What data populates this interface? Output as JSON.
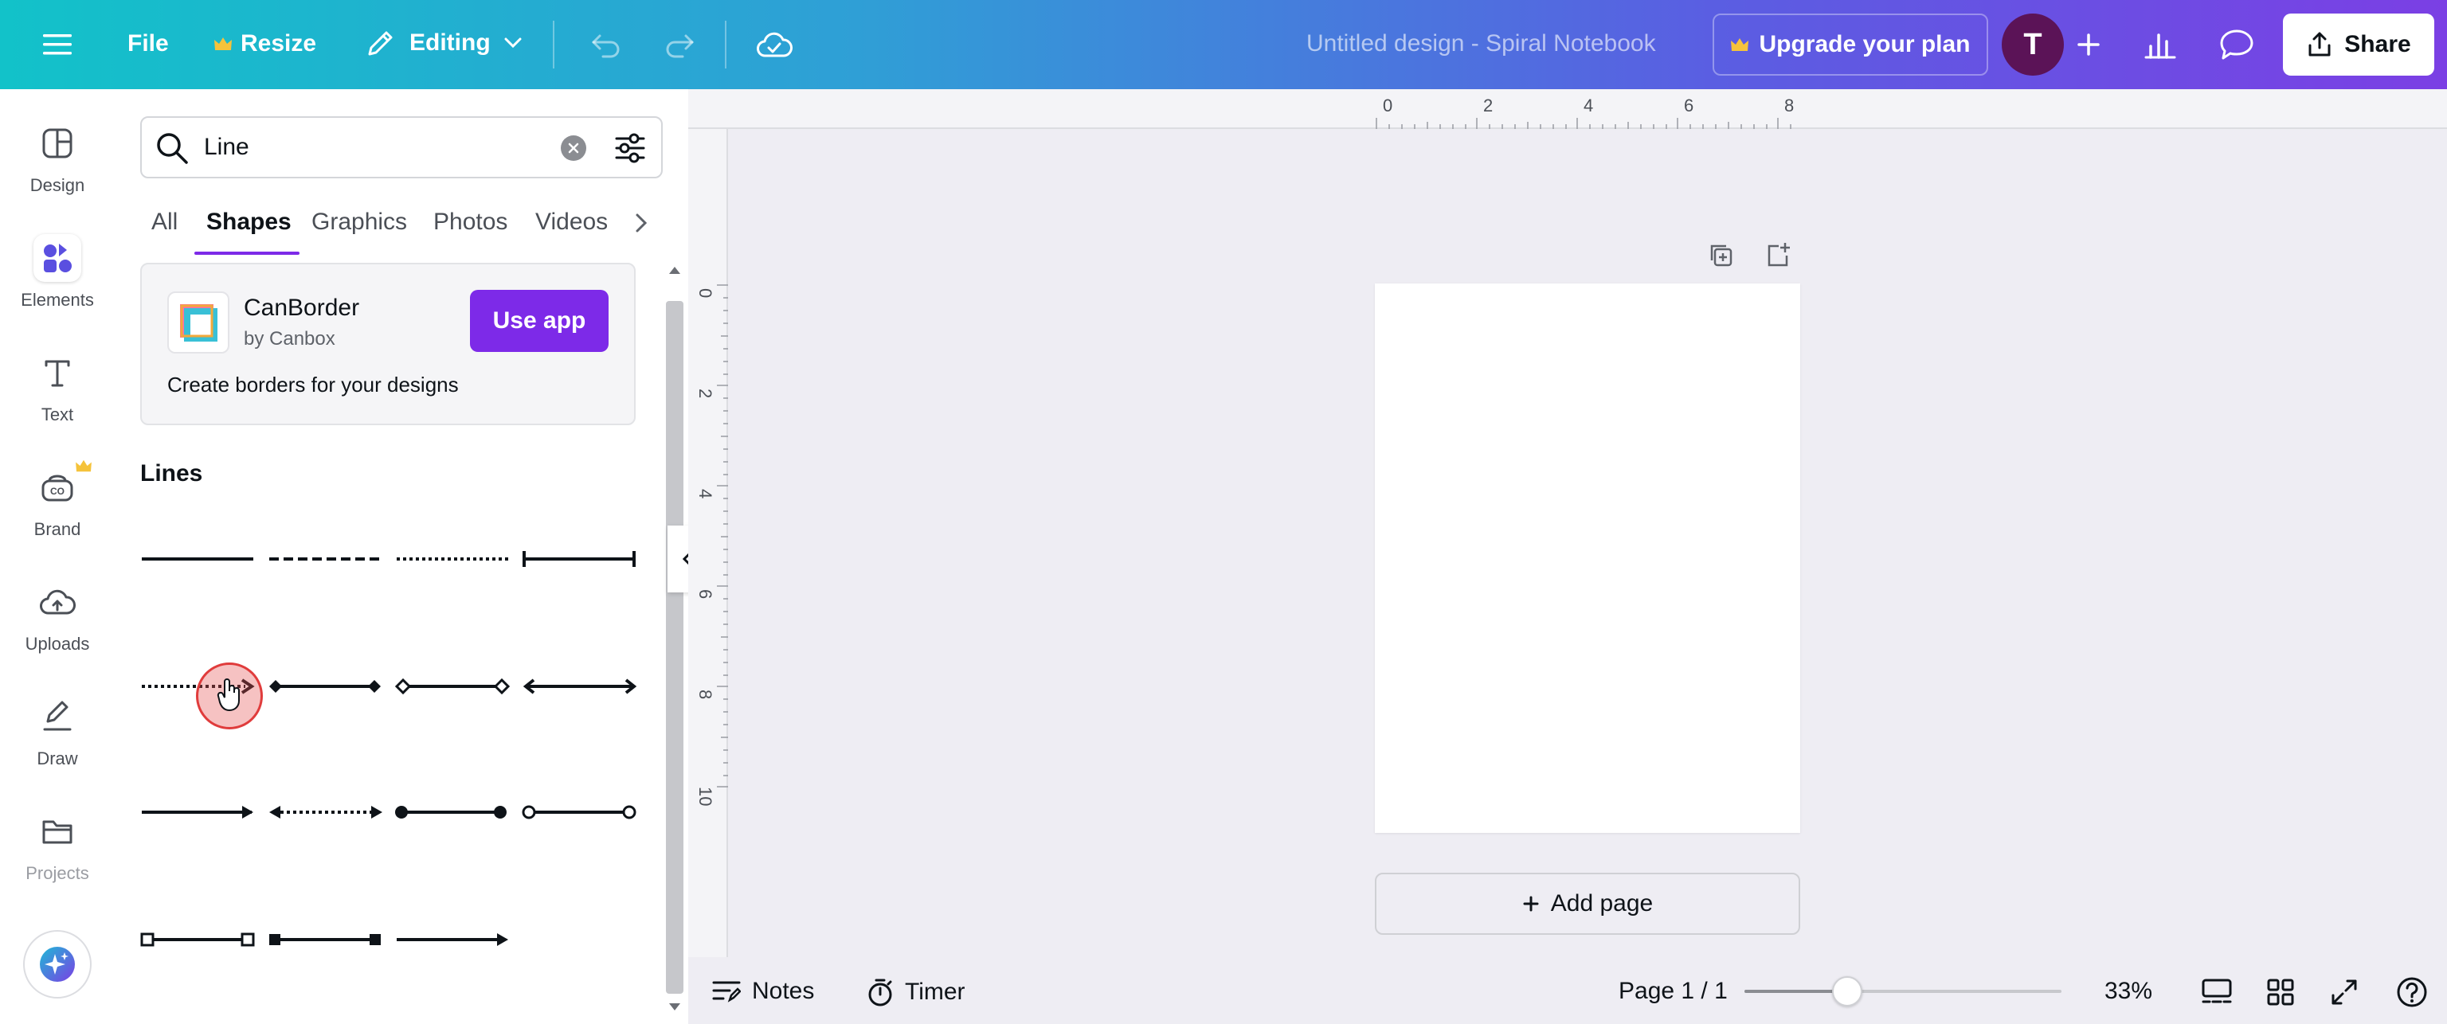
{
  "topbar": {
    "file_label": "File",
    "resize_label": "Resize",
    "editing_label": "Editing",
    "title": "Untitled design - Spiral Notebook",
    "upgrade_label": "Upgrade your plan",
    "avatar_initial": "T",
    "share_label": "Share"
  },
  "rail": {
    "items": [
      {
        "label": "Design"
      },
      {
        "label": "Elements"
      },
      {
        "label": "Text"
      },
      {
        "label": "Brand"
      },
      {
        "label": "Uploads"
      },
      {
        "label": "Draw"
      },
      {
        "label": "Projects"
      }
    ]
  },
  "search": {
    "value": "Line"
  },
  "tabs": [
    {
      "label": "All"
    },
    {
      "label": "Shapes"
    },
    {
      "label": "Graphics"
    },
    {
      "label": "Photos"
    },
    {
      "label": "Videos"
    }
  ],
  "promo": {
    "name": "CanBorder",
    "by": "by Canbox",
    "description": "Create borders for your designs",
    "button": "Use app"
  },
  "lines": {
    "heading": "Lines"
  },
  "ruler": {
    "top": [
      "0",
      "2",
      "4",
      "6",
      "8"
    ],
    "left": [
      "0",
      "2",
      "4",
      "6",
      "8",
      "10"
    ]
  },
  "canvas": {
    "add_page_label": "Add page"
  },
  "bottombar": {
    "notes_label": "Notes",
    "timer_label": "Timer",
    "page_indicator": "Page 1 / 1",
    "zoom_label": "33%",
    "zoom_percent": 33
  },
  "colors": {
    "accent": "#7d2ae8",
    "topbar_start": "#12c2c9",
    "topbar_end": "#7b3fe4",
    "avatar": "#5b1357"
  }
}
